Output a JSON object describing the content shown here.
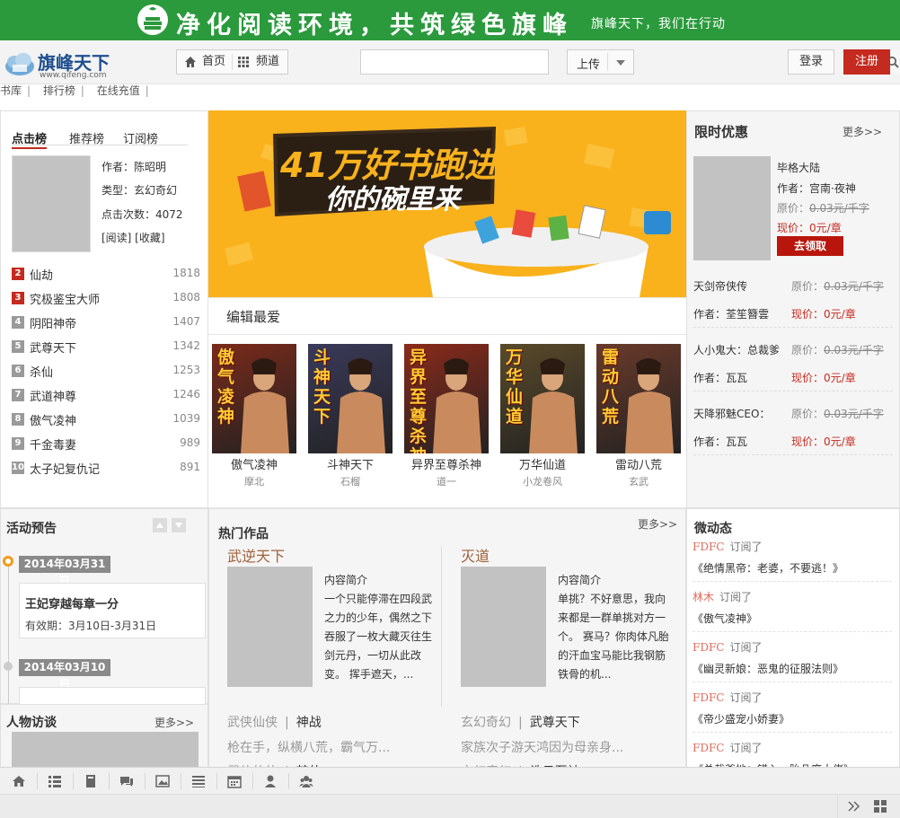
{
  "banner": {
    "slogan": "净化阅读环境，共筑绿色旗峰",
    "sub": "旗峰天下，我们在行动"
  },
  "logo": {
    "cn": "旗峰天下",
    "en": "www.qifeng.com"
  },
  "nav": {
    "home": "首页",
    "channel": "频道",
    "upload": "上传",
    "login": "登录",
    "register": "注册",
    "search_placeholder": ""
  },
  "subnav": [
    "书库",
    "排行榜",
    "在线充值"
  ],
  "rank": {
    "tabs": [
      "点击榜",
      "推荐榜",
      "订阅榜"
    ],
    "featured": {
      "author_label": "作者：陈昭明",
      "type_label": "类型：玄幻奇幻",
      "clicks_label": "点击次数：4072",
      "actions": "[阅读] [收藏]"
    },
    "items": [
      {
        "num": "2",
        "name": "仙劫",
        "count": "1818"
      },
      {
        "num": "3",
        "name": "究极鉴宝大师",
        "count": "1808"
      },
      {
        "num": "4",
        "name": "阴阳神帝",
        "count": "1407"
      },
      {
        "num": "5",
        "name": "武尊天下",
        "count": "1342"
      },
      {
        "num": "6",
        "name": "杀仙",
        "count": "1253"
      },
      {
        "num": "7",
        "name": "武道神尊",
        "count": "1246"
      },
      {
        "num": "8",
        "name": "傲气凌神",
        "count": "1039"
      },
      {
        "num": "9",
        "name": "千金毒妻",
        "count": "989"
      },
      {
        "num": "10",
        "name": "太子妃复仇记",
        "count": "891"
      }
    ]
  },
  "promo": {
    "line1": "41万好书跑进",
    "line2": "你的碗里来"
  },
  "editor": {
    "title": "编辑最爱",
    "books": [
      {
        "title": "傲气凌神",
        "author": "摩北",
        "cover_text": "傲气凌神",
        "color": "#7a2a1a"
      },
      {
        "title": "斗神天下",
        "author": "石榴",
        "cover_text": "斗神天下",
        "color": "#3a3a5a"
      },
      {
        "title": "异界至尊杀神",
        "author": "道一",
        "cover_text": "异界至尊杀神",
        "color": "#8a2a1a"
      },
      {
        "title": "万华仙道",
        "author": "小龙卷风",
        "cover_text": "万华仙道",
        "color": "#5a4a2a"
      },
      {
        "title": "雷动八荒",
        "author": "玄武",
        "cover_text": "雷动八荒",
        "color": "#6a3a2a"
      }
    ]
  },
  "discount": {
    "title": "限时优惠",
    "more": "更多>>",
    "featured": {
      "name": "毕格大陆",
      "author": "作者：宫南·夜神",
      "orig_label": "原价：",
      "orig": "0.03元/千字",
      "now_label": "现价：",
      "now": "0元/章",
      "button": "去领取"
    },
    "items": [
      {
        "name": "天剑帝侠传",
        "author": "作者：荃笙簪雲",
        "orig_label": "原价：",
        "orig": "0.03元/千字",
        "now_label": "现价：",
        "now": "0元/章"
      },
      {
        "name": "人小鬼大：总裁爹",
        "author": "作者：瓦瓦",
        "orig_label": "原价：",
        "orig": "0.03元/千字",
        "now_label": "现价：",
        "now": "0元/章"
      },
      {
        "name": "天降邪魅CEO：",
        "author": "作者：瓦瓦",
        "orig_label": "原价：",
        "orig": "0.03元/千字",
        "now_label": "现价：",
        "now": "0元/章"
      }
    ]
  },
  "events": {
    "title": "活动预告",
    "items": [
      {
        "date": "2014年03月31日",
        "title": "王妃穿越每章一分",
        "period": "有效期：3月10日-3月31日"
      },
      {
        "date": "2014年03月10日",
        "title": "",
        "period": ""
      }
    ]
  },
  "interview": {
    "title": "人物访谈",
    "more": "更多>>"
  },
  "hot": {
    "title": "热门作品",
    "more": "更多>>",
    "cols": [
      {
        "book": "武逆天下",
        "intro_label": "内容简介",
        "intro": "一个只能停滞在四段武之力的少年，偶然之下吞服了一枚大藏灭往生剑元丹，一切从此改变。 挥手遮天，...",
        "cat": "武侠仙侠",
        "cat_book": "神战",
        "line": "枪在手，纵横八荒，霸气万...",
        "cat2": "武侠仙侠",
        "cat2_book": "焚仙"
      },
      {
        "book": "灭道",
        "intro_label": "内容简介",
        "intro": "单挑？不好意思，我向来都是一群单挑对方一个。 赛马？你肉体凡胎的汗血宝马能比我钢筋铁骨的机...",
        "cat": "玄幻奇幻",
        "cat_book": "武尊天下",
        "line": "家族次子游天鸿因为母亲身...",
        "cat2": "玄幻奇幻",
        "cat2_book": "诛日至神"
      }
    ]
  },
  "weibo": {
    "title": "微动态",
    "items": [
      {
        "user": "FDFC",
        "action": "订阅了",
        "book": "《绝情黑帝：老婆，不要逃！》"
      },
      {
        "user": "林木",
        "action": "订阅了",
        "book": "《傲气凌神》"
      },
      {
        "user": "FDFC",
        "action": "订阅了",
        "book": "《幽灵新娘：恶鬼的征服法则》"
      },
      {
        "user": "FDFC",
        "action": "订阅了",
        "book": "《帝少盛宠小娇妻》"
      },
      {
        "user": "FDFC",
        "action": "订阅了",
        "book": "《总裁爹地：错入一胎几度大佬》"
      }
    ]
  },
  "colors": {
    "green": "#2a9a3c",
    "red": "#c42a1f",
    "orange": "#f9b21c"
  },
  "toolbar_icons": [
    "home-icon",
    "list-icon",
    "book-icon",
    "chat-icon",
    "image-icon",
    "layers-icon",
    "calendar-icon",
    "user-icon",
    "group-icon"
  ]
}
